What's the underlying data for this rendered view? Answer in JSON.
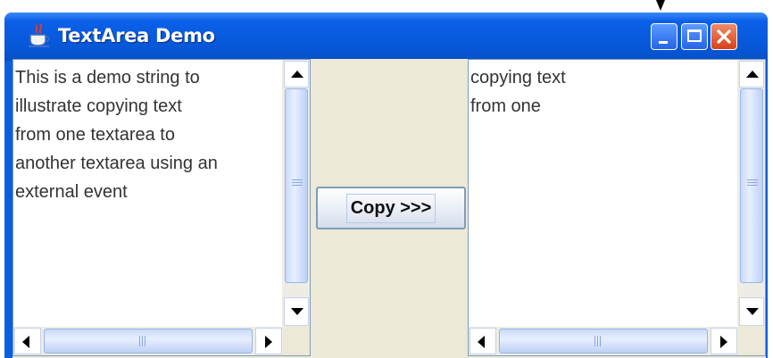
{
  "window": {
    "title": "TextArea Demo",
    "icon": "java-cup-icon",
    "controls": [
      "minimize-icon",
      "maximize-icon",
      "close-icon"
    ]
  },
  "left_textarea": {
    "text": "This is a demo string to\nillustrate copying text\nfrom one textarea to\nanother textarea using an\nexternal event"
  },
  "copy_button": {
    "label": "Copy >>>"
  },
  "right_textarea": {
    "text": "copying text\nfrom one"
  },
  "colors": {
    "titlebar": "#0758D8",
    "close_button": "#D8401A",
    "client_background": "#ECE9D8"
  }
}
